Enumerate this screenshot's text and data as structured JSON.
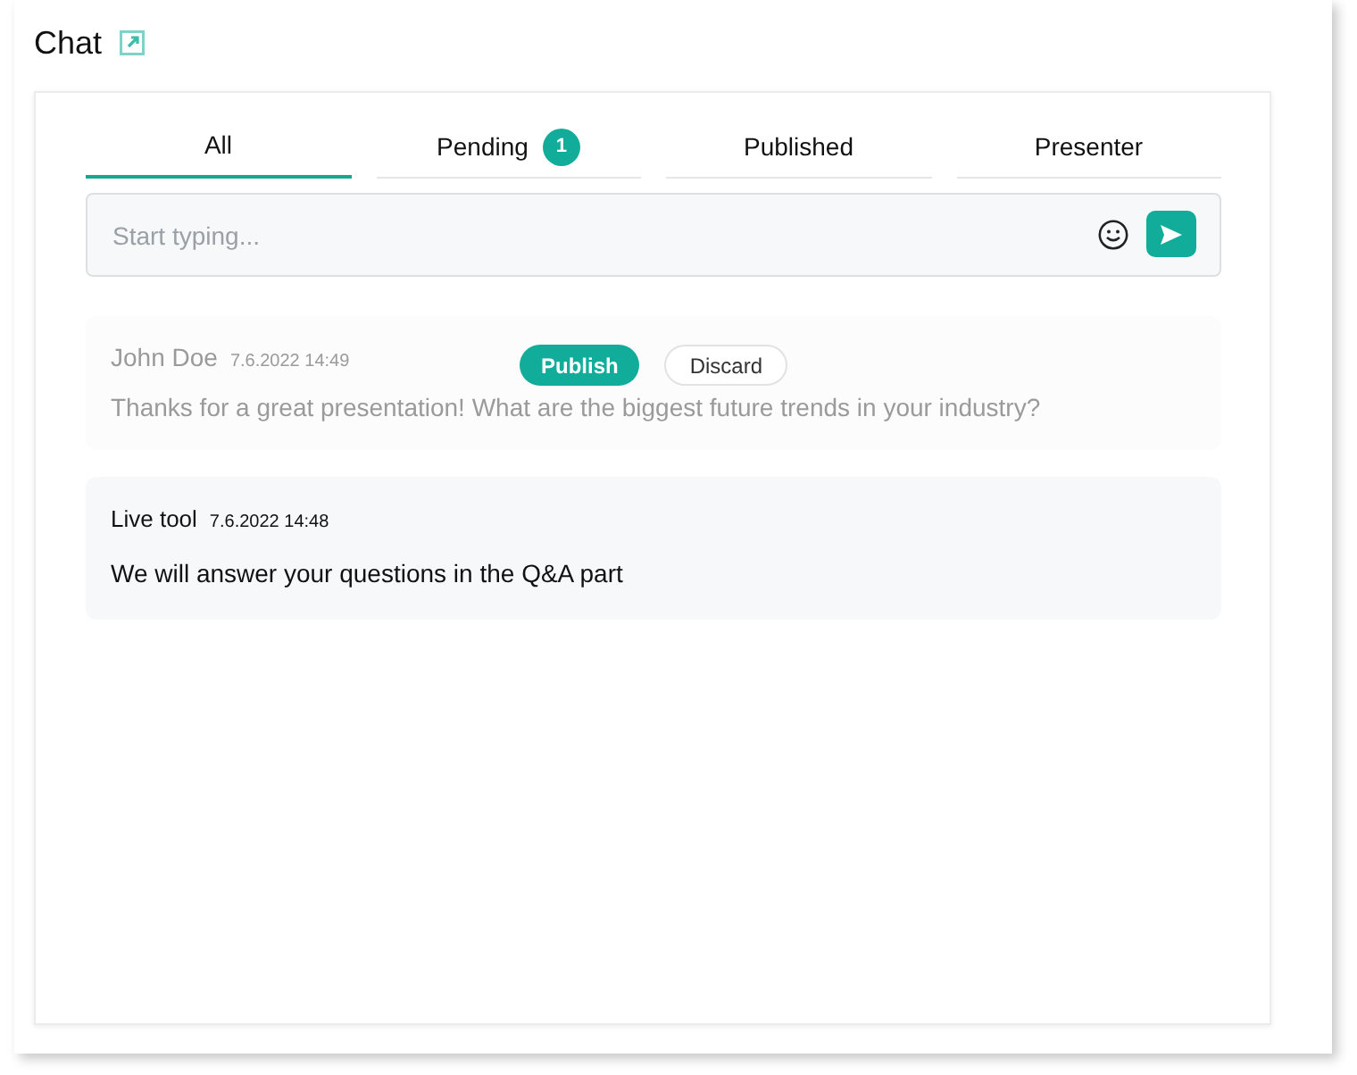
{
  "title": "Chat",
  "tabs": [
    {
      "label": "All",
      "selected": true
    },
    {
      "label": "Pending",
      "selected": false,
      "badge": "1"
    },
    {
      "label": "Published",
      "selected": false
    },
    {
      "label": "Presenter",
      "selected": false
    }
  ],
  "composer": {
    "placeholder": "Start typing..."
  },
  "messages": [
    {
      "author": "John Doe",
      "time": "7.6.2022 14:49",
      "text": "Thanks for a great presentation! What are the biggest future trends in your industry?",
      "pending": true,
      "actions": [
        {
          "label": "Publish",
          "kind": "primary"
        },
        {
          "label": "Discard",
          "kind": "secondary"
        }
      ]
    },
    {
      "author": "Live tool",
      "time": "7.6.2022 14:48",
      "text": "We will answer your questions in the Q&A part",
      "pending": false
    }
  ]
}
